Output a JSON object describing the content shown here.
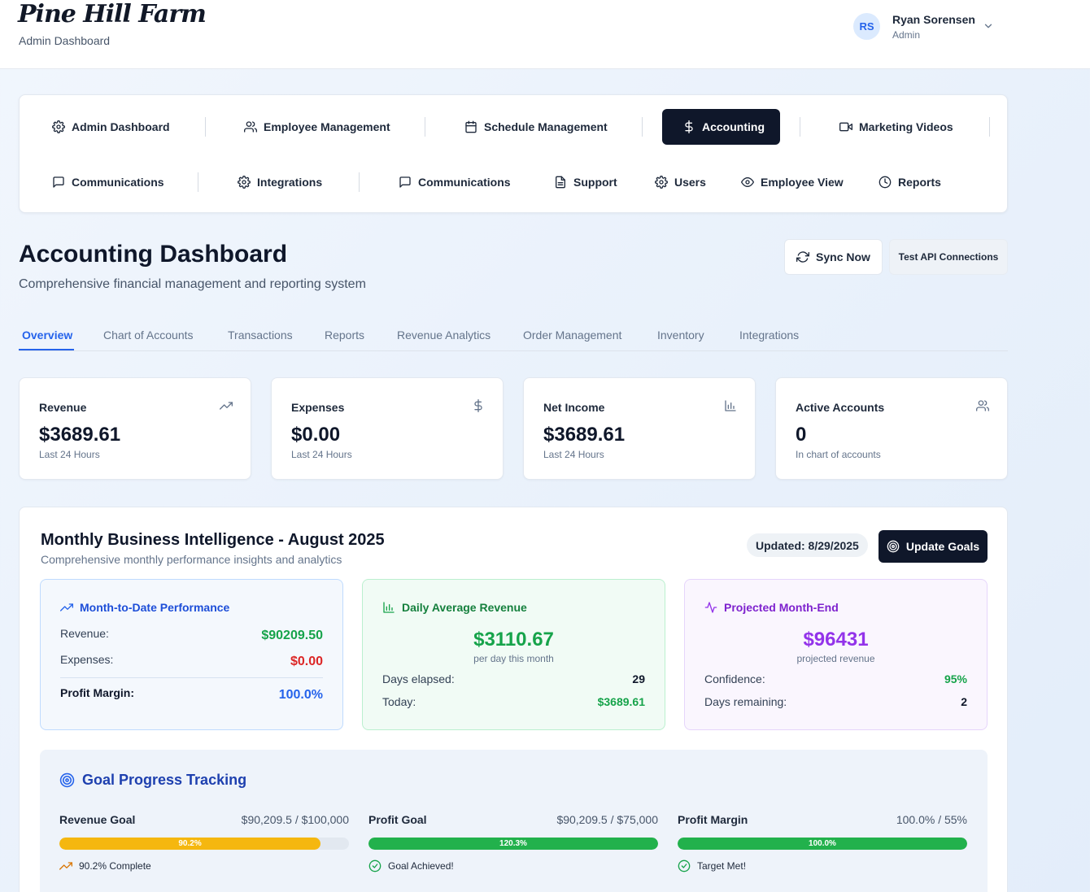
{
  "header": {
    "logo": "Pine Hill Farm",
    "subtitle": "Admin Dashboard",
    "user": {
      "initials": "RS",
      "name": "Ryan Sorensen",
      "role": "Admin"
    }
  },
  "nav": {
    "row1": [
      {
        "label": "Admin Dashboard",
        "icon": "gear-icon"
      },
      {
        "label": "Employee Management",
        "icon": "users-icon"
      },
      {
        "label": "Schedule Management",
        "icon": "calendar-icon"
      },
      {
        "label": "Accounting",
        "icon": "dollar-icon",
        "active": true
      },
      {
        "label": "Marketing Videos",
        "icon": "video-icon"
      }
    ],
    "row2": [
      {
        "label": "Communications",
        "icon": "chat-icon"
      },
      {
        "label": "Integrations",
        "icon": "gear-icon"
      },
      {
        "label": "Communications",
        "icon": "chat-icon"
      },
      {
        "label": "Support",
        "icon": "document-icon"
      },
      {
        "label": "Users",
        "icon": "gear-icon"
      },
      {
        "label": "Employee View",
        "icon": "eye-icon"
      },
      {
        "label": "Reports",
        "icon": "clock-icon"
      }
    ]
  },
  "page": {
    "title": "Accounting Dashboard",
    "subtitle": "Comprehensive financial management and reporting system",
    "sync_label": "Sync Now",
    "test_label": "Test API Connections"
  },
  "tabs": [
    "Overview",
    "Chart of Accounts",
    "Transactions",
    "Reports",
    "Revenue Analytics",
    "Order Management",
    "Inventory",
    "Integrations"
  ],
  "stats": [
    {
      "label": "Revenue",
      "value": "$3689.61",
      "note": "Last 24 Hours",
      "icon": "trending-up-icon"
    },
    {
      "label": "Expenses",
      "value": "$0.00",
      "note": "Last 24 Hours",
      "icon": "dollar-icon"
    },
    {
      "label": "Net Income",
      "value": "$3689.61",
      "note": "Last 24 Hours",
      "icon": "bar-chart-icon"
    },
    {
      "label": "Active Accounts",
      "value": "0",
      "note": "In chart of accounts",
      "icon": "users-icon"
    }
  ],
  "bi": {
    "title": "Monthly Business Intelligence - August 2025",
    "subtitle": "Comprehensive monthly performance insights and analytics",
    "updated": "Updated: 8/29/2025",
    "update_goals_label": "Update Goals",
    "mtd": {
      "title": "Month-to-Date Performance",
      "revenue_label": "Revenue:",
      "revenue": "$90209.50",
      "expenses_label": "Expenses:",
      "expenses": "$0.00",
      "margin_label": "Profit Margin:",
      "margin": "100.0%"
    },
    "daily": {
      "title": "Daily Average Revenue",
      "value": "$3110.67",
      "caption": "per day this month",
      "elapsed_label": "Days elapsed:",
      "elapsed": "29",
      "today_label": "Today:",
      "today": "$3689.61"
    },
    "projected": {
      "title": "Projected Month-End",
      "value": "$96431",
      "caption": "projected revenue",
      "confidence_label": "Confidence:",
      "confidence": "95%",
      "remaining_label": "Days remaining:",
      "remaining": "2"
    }
  },
  "goals": {
    "title": "Goal Progress Tracking",
    "items": [
      {
        "label": "Revenue Goal",
        "value": "$90,209.5 / $100,000",
        "percent_text": "90.2%",
        "progress": 0.902,
        "note": "90.2% Complete",
        "color": "#f5b70f"
      },
      {
        "label": "Profit Goal",
        "value": "$90,209.5 / $75,000",
        "percent_text": "120.3%",
        "progress": 1.0,
        "note": "Goal Achieved!",
        "color": "#22b14c"
      },
      {
        "label": "Profit Margin",
        "value": "100.0% / 55%",
        "percent_text": "100.0%",
        "progress": 1.0,
        "note": "Target Met!",
        "color": "#22b14c"
      }
    ]
  },
  "colors": {
    "accent_blue": "#2563eb",
    "green": "#16a34a",
    "red": "#dc2626",
    "purple": "#9333ea",
    "dark": "#0f172a"
  }
}
